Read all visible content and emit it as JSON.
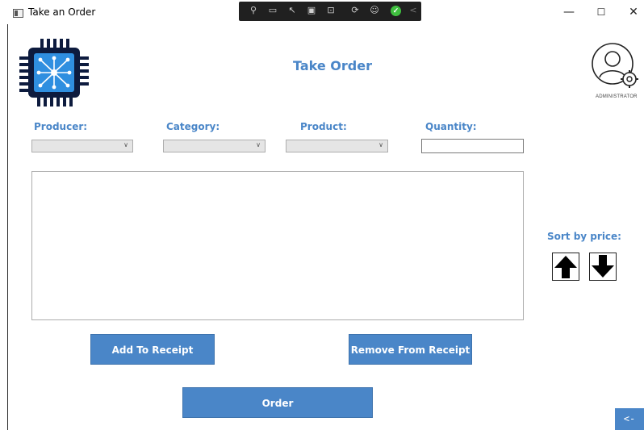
{
  "window": {
    "title": "Take an Order",
    "controls": {
      "minimize": "—",
      "maximize": "☐",
      "close": "✕"
    }
  },
  "debug_toolbar": {
    "icons": [
      "select-element-icon",
      "record-icon",
      "pointer-icon",
      "layout-icon",
      "track-focus-icon",
      "hot-reload-icon",
      "accessibility-icon",
      "status-ok-icon"
    ],
    "ok_glyph": "✓",
    "collapse_glyph": "<"
  },
  "header": {
    "page_title": "Take Order",
    "user_role": "ADMINISTRATOR"
  },
  "form": {
    "producer": {
      "label": "Producer:",
      "value": ""
    },
    "category": {
      "label": "Category:",
      "value": ""
    },
    "product": {
      "label": "Product:",
      "value": ""
    },
    "quantity": {
      "label": "Quantity:",
      "value": ""
    }
  },
  "sort": {
    "label": "Sort by price:"
  },
  "buttons": {
    "add": "Add To Receipt",
    "remove": "Remove From Receipt",
    "order": "Order",
    "back": "<-"
  },
  "colors": {
    "accent": "#4a86c8",
    "accent_border": "#3e73ad"
  }
}
